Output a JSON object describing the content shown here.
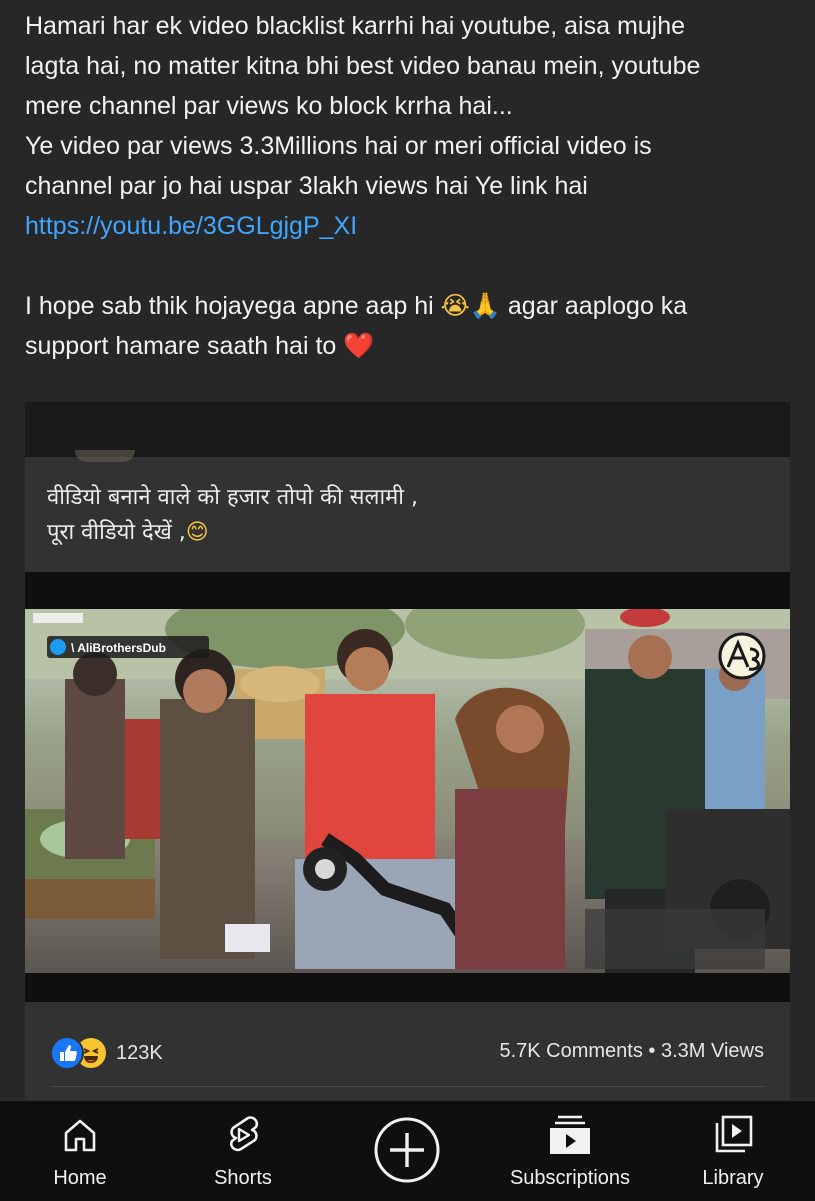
{
  "post": {
    "lines": [
      "Hamari har ek video blacklist karrhi hai youtube, aisa mujhe",
      "lagta hai, no matter kitna bhi best video banau mein, youtube",
      "mere channel par views ko block krrha hai...",
      "Ye video par views 3.3Millions hai or meri official video is",
      "channel par jo hai uspar 3lakh views hai Ye link hai"
    ],
    "link": "https://youtu.be/3GGLgjgP_XI",
    "hope_text": "I hope sab thik hojayega apne aap hi",
    "hope_emoji": "😭🙏",
    "support_after": " agar aaplogo ka",
    "support_line": "support hamare saath hai to",
    "heart_emoji": "❤️"
  },
  "shared_card": {
    "caption_line1": "वीडियो बनाने वाले को हजार तोपो की सलामी ,",
    "caption_line2": "पूरा वीडियो देखें ,",
    "caption_emoji": "😊",
    "watermark_handle": "\\ AliBrothersDub",
    "reaction_count": "123K",
    "comments": "5.7K Comments",
    "separator": "•",
    "views": "3.3M Views"
  },
  "nav": {
    "items": [
      {
        "label": "Home",
        "icon": "home-icon"
      },
      {
        "label": "Shorts",
        "icon": "shorts-icon"
      },
      {
        "label": "",
        "icon": "create-plus-icon"
      },
      {
        "label": "Subscriptions",
        "icon": "subscriptions-icon"
      },
      {
        "label": "Library",
        "icon": "library-icon"
      }
    ]
  },
  "colors": {
    "background": "#272727",
    "text": "#f1f1f1",
    "link": "#3ea6ff",
    "card": "#323232",
    "nav_bar": "#0f0f0f",
    "like_blue": "#1877f2"
  }
}
